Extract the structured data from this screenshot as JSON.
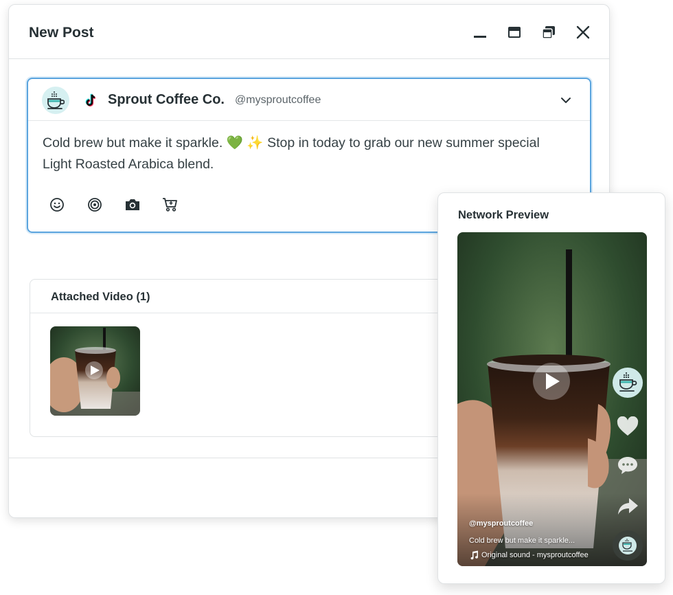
{
  "window": {
    "title": "New Post"
  },
  "composer": {
    "account_name": "Sprout Coffee Co.",
    "account_handle": "@mysproutcoffee",
    "network_icon": "tiktok-icon",
    "post_text_line1": "Cold brew but make it sparkle. 💚 ✨ Stop in today to grab our new summer special",
    "post_text_line2": "Light Roasted Arabica blend.",
    "tools": [
      "emoji-icon",
      "target-icon",
      "camera-icon",
      "cart-icon"
    ]
  },
  "attached": {
    "title": "Attached Video (1)"
  },
  "preview": {
    "title": "Network Preview",
    "video_handle": "@mysproutcoffee",
    "video_caption": "Cold brew but make it sparkle...",
    "video_sound": "Original sound - mysproutcoffee"
  },
  "colors": {
    "accent_blue": "#5aa4de",
    "avatar_bg": "#d6f0f1",
    "text_dark": "#273135",
    "tiktok_pink": "#fe2c55",
    "tiktok_cyan": "#25f4ee"
  }
}
